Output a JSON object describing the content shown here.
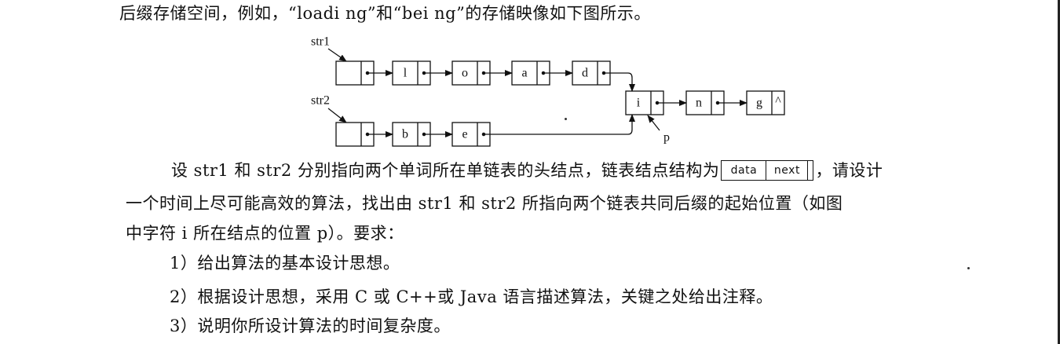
{
  "intro_line": "后缀存储空间，例如，“loadi ng”和“bei ng”的存储映像如下图所示。",
  "diagram": {
    "labels": {
      "str1": "str1",
      "str2": "str2",
      "p": "p"
    },
    "list1": [
      "",
      "l",
      "o",
      "a",
      "d"
    ],
    "list2": [
      "",
      "b",
      "e"
    ],
    "shared": [
      "i",
      "n",
      "g"
    ],
    "null_mark": "^"
  },
  "body": {
    "p1_before": "设 str1 和 str2 分别指向两个单词所在单链表的头结点，链表结点结构为",
    "node_field1": "data",
    "node_field2": "next",
    "p1_after": "，请设计",
    "p2": "一个时间上尽可能高效的算法，找出由 str1 和 str2 所指向两个链表共同后缀的起始位置（如图",
    "p3": "中字符 i 所在结点的位置 p）。要求："
  },
  "requirements": [
    "1）给出算法的基本设计思想。",
    "2）根据设计思想，采用 C 或 C++或 Java 语言描述算法，关键之处给出注释。",
    "3）说明你所设计算法的时间复杂度。"
  ]
}
